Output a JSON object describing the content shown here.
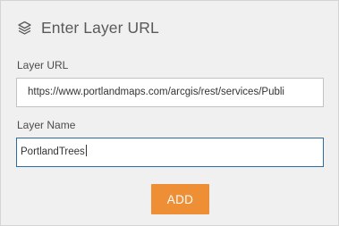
{
  "header": {
    "icon": "layers-icon",
    "title": "Enter Layer URL"
  },
  "form": {
    "url_label": "Layer URL",
    "url_value": "https://www.portlandmaps.com/arcgis/rest/services/Publi",
    "name_label": "Layer Name",
    "name_value": "PortlandTrees",
    "name_focused": true,
    "add_button_label": "ADD"
  },
  "colors": {
    "panel_background": "#f0f0f0",
    "button_accent": "#ee8f35",
    "focus_border": "#2d6ca2"
  }
}
